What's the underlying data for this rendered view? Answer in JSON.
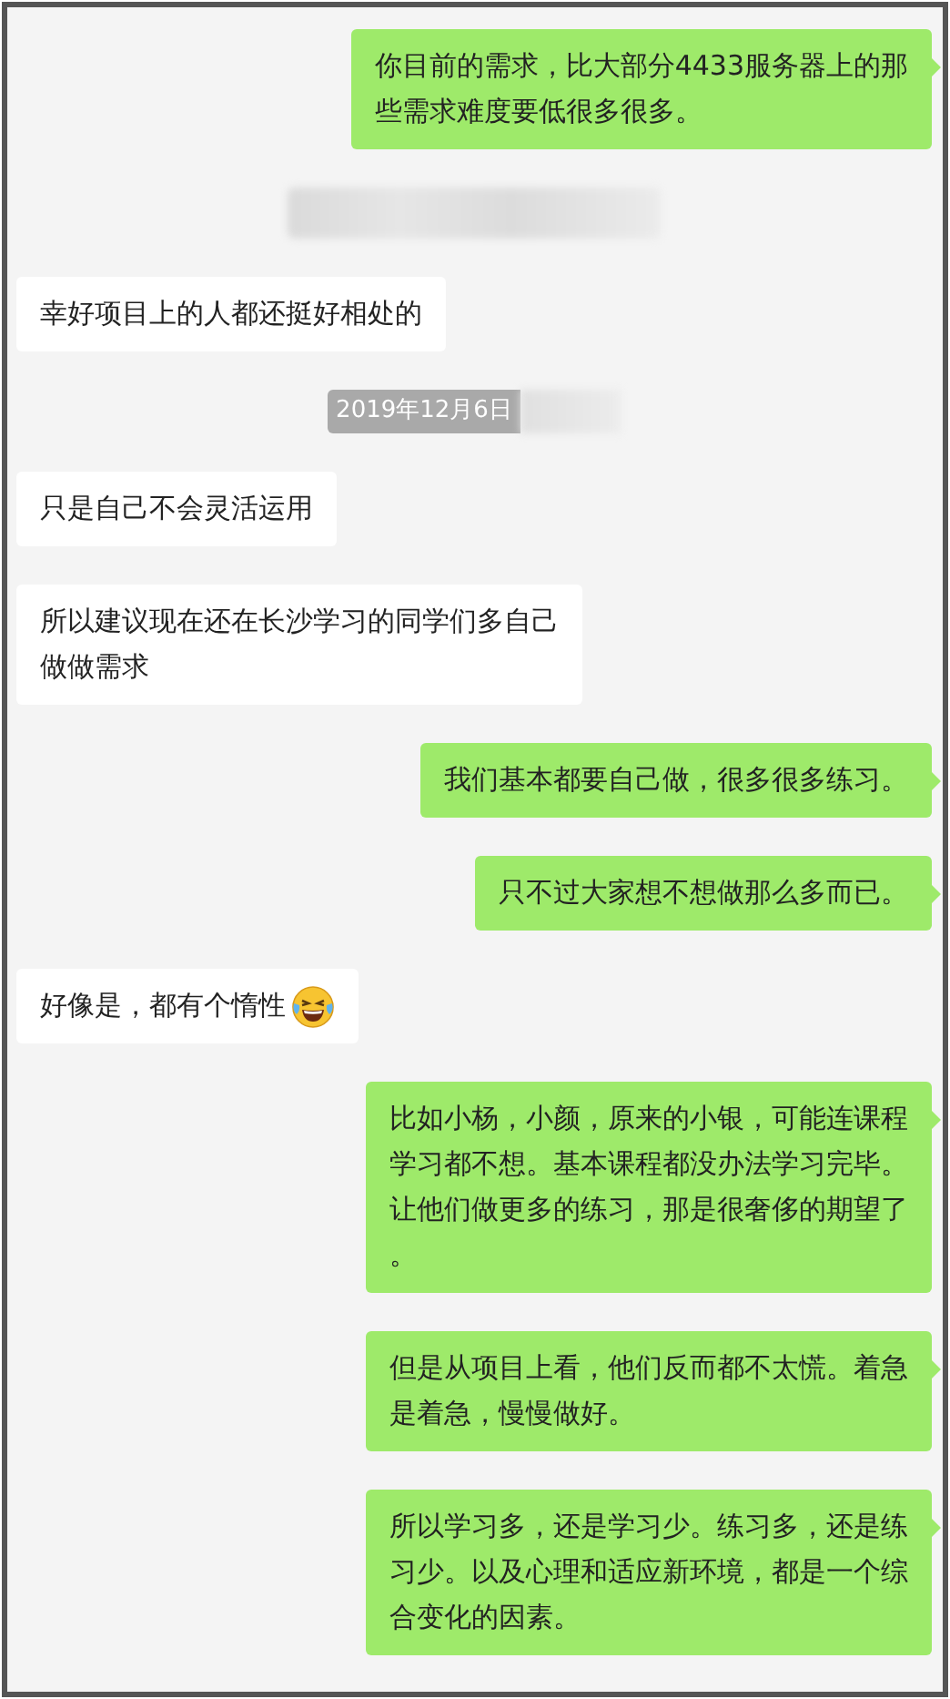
{
  "messages": [
    {
      "kind": "sent",
      "lines": [
        "你目前的需求，比大部分4433服务器上的那",
        "些需求难度要低很多很多。"
      ]
    },
    {
      "kind": "notice"
    },
    {
      "kind": "received",
      "lines": [
        "幸好项目上的人都还挺好相处的"
      ]
    },
    {
      "kind": "timestamp",
      "text": "2019年12月6日"
    },
    {
      "kind": "received",
      "lines": [
        "只是自己不会灵活运用"
      ]
    },
    {
      "kind": "received",
      "lines": [
        "所以建议现在还在长沙学习的同学们多自己",
        "做做需求"
      ]
    },
    {
      "kind": "sent",
      "lines": [
        "我们基本都要自己做，很多很多练习。"
      ]
    },
    {
      "kind": "sent",
      "lines": [
        "只不过大家想不想做那么多而已。"
      ]
    },
    {
      "kind": "received",
      "lines": [
        "好像是，都有个惰性"
      ],
      "emoji": true
    },
    {
      "kind": "sent",
      "lines": [
        "比如小杨，小颜，原来的小银，可能连课程",
        "学习都不想。基本课程都没办法学习完毕。",
        "让他们做更多的练习，那是很奢侈的期望了",
        "。"
      ]
    },
    {
      "kind": "sent",
      "lines": [
        "但是从项目上看，他们反而都不太慌。着急",
        "是着急，慢慢做好。"
      ]
    },
    {
      "kind": "sent",
      "lines": [
        "所以学习多，还是学习少。练习多，还是练",
        "习少。以及心理和适应新环境，都是一个综",
        "合变化的因素。"
      ]
    }
  ]
}
